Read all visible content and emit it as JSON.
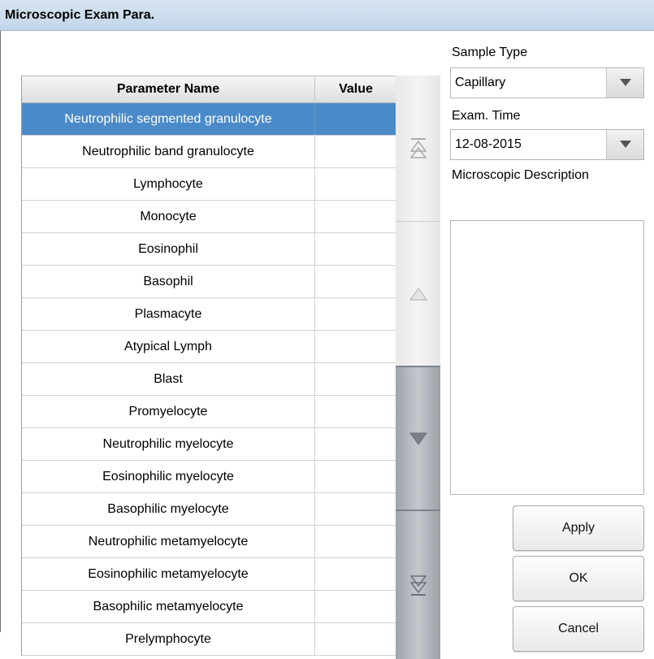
{
  "window": {
    "title": "Microscopic Exam Para."
  },
  "table": {
    "headers": {
      "name": "Parameter Name",
      "value": "Value"
    },
    "rows": [
      {
        "name": "Neutrophilic segmented granulocyte",
        "value": ""
      },
      {
        "name": "Neutrophilic band granulocyte",
        "value": ""
      },
      {
        "name": "Lymphocyte",
        "value": ""
      },
      {
        "name": "Monocyte",
        "value": ""
      },
      {
        "name": "Eosinophil",
        "value": ""
      },
      {
        "name": "Basophil",
        "value": ""
      },
      {
        "name": "Plasmacyte",
        "value": ""
      },
      {
        "name": "Atypical Lymph",
        "value": ""
      },
      {
        "name": "Blast",
        "value": ""
      },
      {
        "name": "Promyelocyte",
        "value": ""
      },
      {
        "name": "Neutrophilic myelocyte",
        "value": ""
      },
      {
        "name": "Eosinophilic myelocyte",
        "value": ""
      },
      {
        "name": "Basophilic myelocyte",
        "value": ""
      },
      {
        "name": "Neutrophilic metamyelocyte",
        "value": ""
      },
      {
        "name": "Eosinophilic metamyelocyte",
        "value": ""
      },
      {
        "name": "Basophilic metamyelocyte",
        "value": ""
      },
      {
        "name": "Prelymphocyte",
        "value": ""
      }
    ],
    "selected_row": 0
  },
  "sample_type": {
    "label": "Sample Type",
    "value": "Capillary"
  },
  "exam_time": {
    "label": "Exam. Time",
    "value": "12-08-2015"
  },
  "description": {
    "label": "Microscopic Description",
    "value": ""
  },
  "buttons": {
    "apply": "Apply",
    "ok": "OK",
    "cancel": "Cancel"
  },
  "colors": {
    "selection": "#4b8ac8",
    "title_bar": "#c9dbee"
  }
}
